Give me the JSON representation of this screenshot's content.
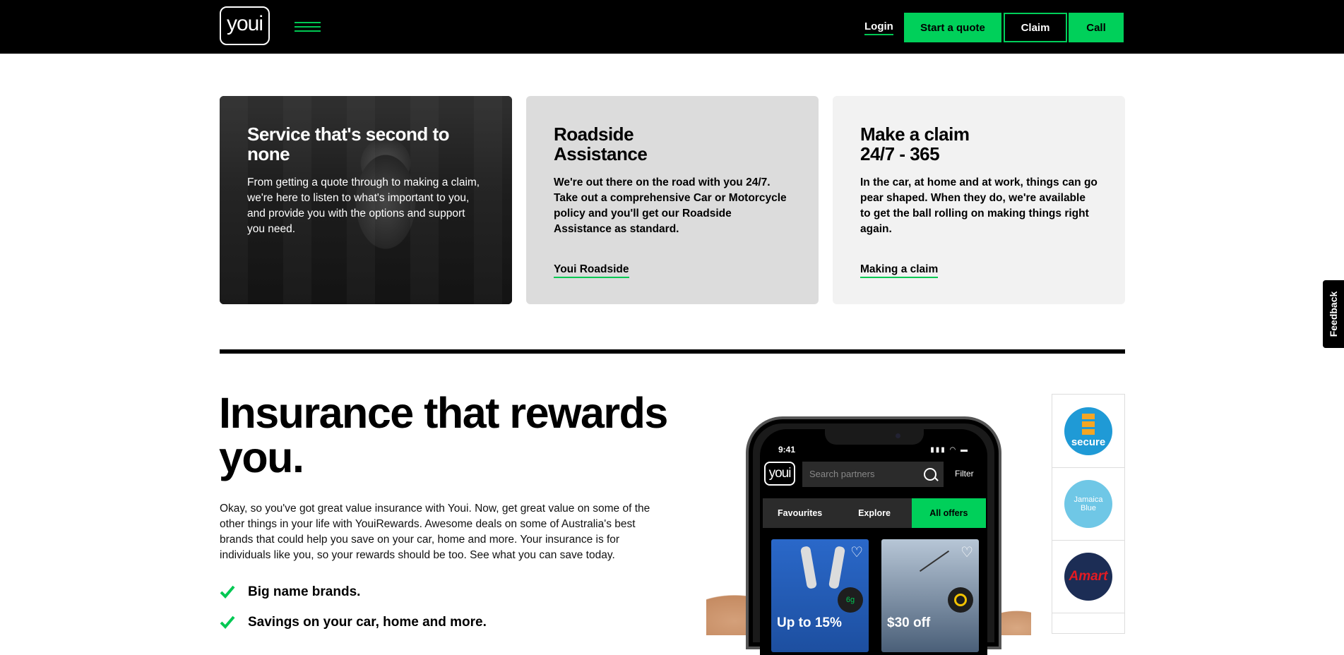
{
  "header": {
    "logo": "youi",
    "login": "Login",
    "start_quote": "Start a quote",
    "claim": "Claim",
    "call": "Call"
  },
  "cards": [
    {
      "title": "Service that's second to none",
      "body": "From getting a quote through to making a claim, we're here to listen to what's important to you, and provide you with the options and support you need."
    },
    {
      "title": "Roadside Assistance",
      "body": "We're out there on the road with you 24/7. Take out a comprehensive Car or Motorcycle policy and you'll get our Roadside Assistance as standard.",
      "link": "Youi Roadside"
    },
    {
      "title": "Make a claim 24/7 - 365",
      "body": "In the car, at home and at work, things can go pear shaped. When they do, we're available to get the ball rolling on making things right again.",
      "link": "Making a claim"
    }
  ],
  "rewards": {
    "headline": "Insurance that rewards you.",
    "body": "Okay, so you've got great value insurance with Youi. Now, get great value on some of the other things in your life with YouiRewards. Awesome deals on some of Australia's best brands that could help you save on your car, home and more. Your insurance is for individuals like you, so your rewards should be too. See what you can save today.",
    "checks": [
      "Big name brands.",
      "Savings on your car, home and more."
    ]
  },
  "phone": {
    "time": "9:41",
    "logo": "youi",
    "search_placeholder": "Search partners",
    "filter": "Filter",
    "tabs": [
      "Favourites",
      "Explore",
      "All offers"
    ],
    "active_tab": "All offers",
    "offers": [
      {
        "deal": "Up to 15%",
        "badge": "6g"
      },
      {
        "deal": "$30 off",
        "badge": ""
      }
    ]
  },
  "partners": [
    {
      "name": "secure"
    },
    {
      "name": "Jamaica Blue"
    },
    {
      "name": "Amart"
    }
  ],
  "feedback": "Feedback",
  "colors": {
    "accent": "#00d05a",
    "header_bg": "#000000"
  }
}
